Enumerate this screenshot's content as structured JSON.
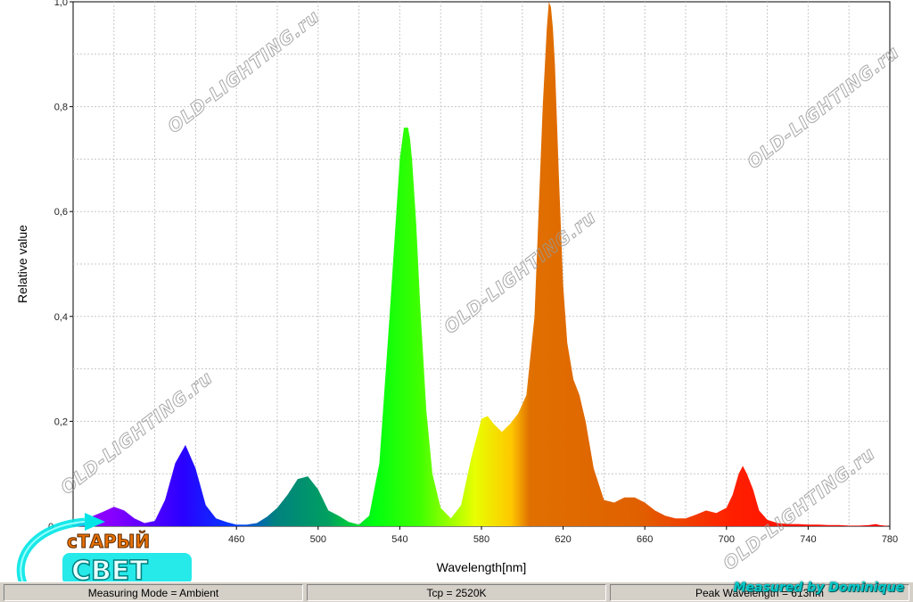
{
  "chart_data": {
    "type": "area",
    "xlabel": "Wavelength[nm]",
    "ylabel": "Relative value",
    "xlim": [
      380,
      780
    ],
    "ylim": [
      0,
      1.0
    ],
    "x_ticks": [
      {
        "value": 460,
        "label": "460"
      },
      {
        "value": 500,
        "label": "500"
      },
      {
        "value": 540,
        "label": "540"
      },
      {
        "value": 580,
        "label": "580"
      },
      {
        "value": 620,
        "label": "620"
      },
      {
        "value": 660,
        "label": "660"
      },
      {
        "value": 700,
        "label": "700"
      },
      {
        "value": 740,
        "label": "740"
      },
      {
        "value": 780,
        "label": "780"
      }
    ],
    "y_ticks": [
      {
        "value": 0.2,
        "label": "0,2"
      },
      {
        "value": 0.4,
        "label": "0,4"
      },
      {
        "value": 0.6,
        "label": "0,6"
      },
      {
        "value": 0.8,
        "label": "0,8"
      },
      {
        "value": 1.0,
        "label": "1,0"
      }
    ],
    "grid": true,
    "fill": "spectral",
    "series": [
      {
        "x": [
          380,
          385,
          390,
          395,
          400,
          405,
          410,
          415,
          420,
          425,
          430,
          435,
          440,
          445,
          450,
          455,
          460,
          465,
          470,
          475,
          480,
          485,
          490,
          495,
          500,
          505,
          510,
          515,
          520,
          525,
          530,
          535,
          540,
          542,
          544,
          545,
          546,
          548,
          550,
          553,
          556,
          560,
          565,
          570,
          575,
          580,
          583,
          586,
          590,
          594,
          598,
          602,
          606,
          608,
          610,
          612,
          613,
          614,
          615,
          616,
          618,
          620,
          622,
          625,
          628,
          631,
          635,
          640,
          645,
          650,
          655,
          660,
          665,
          670,
          675,
          680,
          685,
          690,
          695,
          700,
          703,
          706,
          708,
          710,
          713,
          716,
          720,
          725,
          730,
          735,
          740,
          745,
          750,
          755,
          760,
          765,
          770,
          773,
          775,
          780
        ],
        "y": [
          0.0,
          0.01,
          0.02,
          0.028,
          0.037,
          0.03,
          0.015,
          0.006,
          0.01,
          0.05,
          0.12,
          0.155,
          0.11,
          0.04,
          0.015,
          0.008,
          0.003,
          0.003,
          0.006,
          0.018,
          0.035,
          0.06,
          0.09,
          0.095,
          0.07,
          0.03,
          0.02,
          0.008,
          0.003,
          0.02,
          0.12,
          0.4,
          0.7,
          0.76,
          0.76,
          0.74,
          0.7,
          0.58,
          0.42,
          0.22,
          0.1,
          0.035,
          0.015,
          0.04,
          0.13,
          0.205,
          0.21,
          0.195,
          0.18,
          0.195,
          0.215,
          0.25,
          0.4,
          0.6,
          0.8,
          0.95,
          1.0,
          0.99,
          0.95,
          0.88,
          0.66,
          0.46,
          0.35,
          0.28,
          0.25,
          0.2,
          0.11,
          0.05,
          0.045,
          0.055,
          0.055,
          0.045,
          0.03,
          0.02,
          0.015,
          0.015,
          0.022,
          0.03,
          0.025,
          0.035,
          0.06,
          0.1,
          0.115,
          0.1,
          0.07,
          0.03,
          0.012,
          0.006,
          0.004,
          0.004,
          0.003,
          0.003,
          0.002,
          0.002,
          0.001,
          0.001,
          0.002,
          0.004,
          0.002,
          0.0
        ]
      }
    ],
    "watermark_text": "OLD-LIGHTING.ru"
  },
  "status_bar": {
    "measuring_mode": "Measuring Mode = Ambient",
    "tcp": "Tcp = 2520K",
    "peak": "Peak Wavelength = 613nm"
  },
  "credit": "Measured by Dominique",
  "logo": {
    "top": "сТАРЫЙ",
    "bottom": "СВЕТ"
  },
  "colors": {
    "grid": "#c8c8c8",
    "status_bg": "#d4d0c8",
    "credit": "#00c8c8",
    "logo_glow": "#00e5e5"
  }
}
